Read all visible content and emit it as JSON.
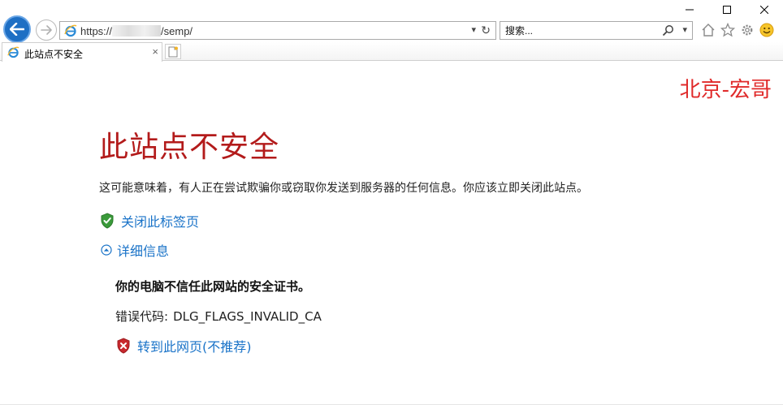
{
  "browser": {
    "address": {
      "prefix": "https://",
      "path": "/semp/",
      "dropdown_glyph": "▾",
      "refresh_glyph": "↻"
    },
    "search": {
      "placeholder": "搜索...",
      "dropdown_glyph": "▾"
    },
    "tab": {
      "label": "此站点不安全",
      "close_glyph": "×"
    },
    "icons": [
      "back-icon",
      "forward-icon",
      "ie-icon",
      "search-icon",
      "home-icon",
      "favorites-star-icon",
      "settings-gear-icon",
      "smiley-feedback-icon",
      "new-tab-icon"
    ]
  },
  "watermark": "北京-宏哥",
  "page": {
    "title": "此站点不安全",
    "warning": "这可能意味着，有人正在尝试欺骗你或窃取你发送到服务器的任何信息。你应该立即关闭此站点。",
    "close_link": "关闭此标签页",
    "details_link": "详细信息",
    "details": {
      "heading": "你的电脑不信任此网站的安全证书。",
      "error_label": "错误代码:",
      "error_value": "DLG_FLAGS_INVALID_CA",
      "proceed_link": "转到此网页(不推荐)"
    }
  },
  "colors": {
    "title": "#b31b1b",
    "link": "#1a73c8",
    "watermark": "#e02a2a",
    "back_button": "#1e6fc4",
    "shield_green": "#3a9a3a",
    "shield_red": "#c8282e"
  }
}
